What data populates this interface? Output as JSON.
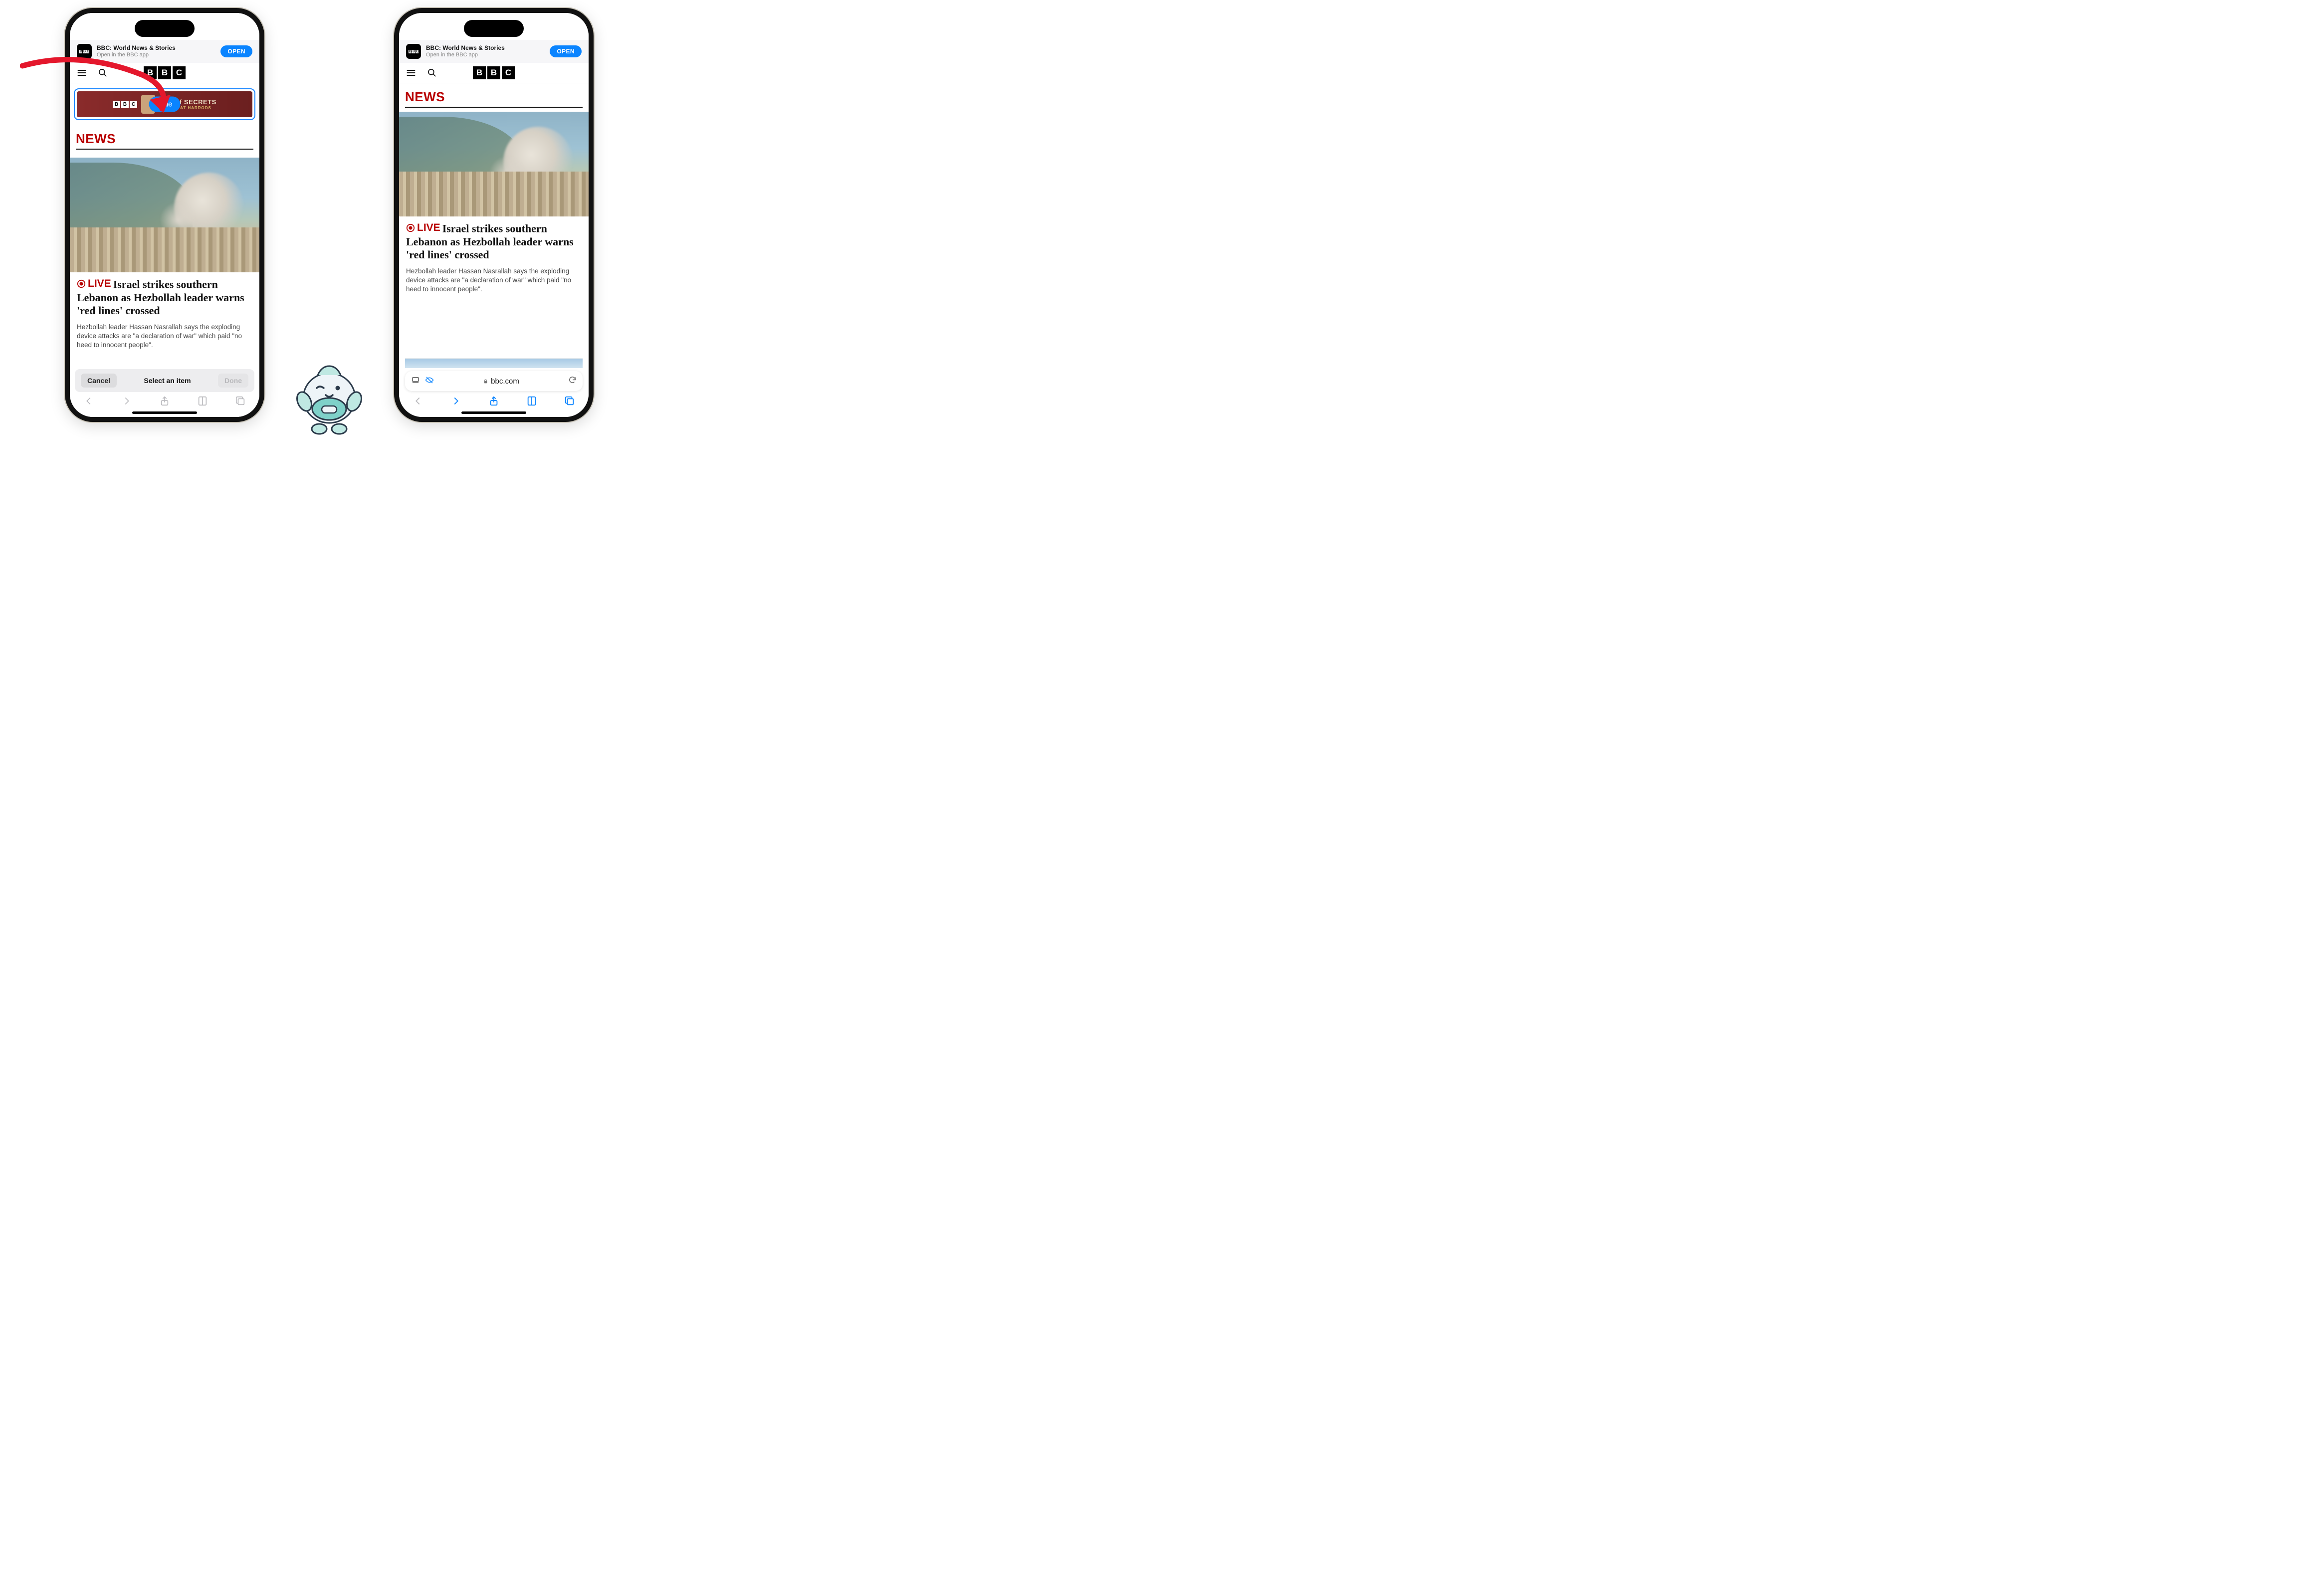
{
  "app_banner": {
    "title": "BBC: World News & Stories",
    "subtitle": "Open in the BBC app",
    "open_label": "OPEN"
  },
  "logo_letters": [
    "B",
    "B",
    "C"
  ],
  "ad": {
    "hide_label": "Hide",
    "text_top": "RLD of SECRETS",
    "text_bottom": "EDATOR AT HARRODS"
  },
  "section_heading": "NEWS",
  "article": {
    "live_label": "LIVE",
    "headline": "Israel strikes southern Lebanon as Hezbollah leader warns 'red lines' crossed",
    "summary": "Hezbollah leader Hassan Nasrallah says the exploding device attacks are \"a declaration of war\" which paid \"no heed to innocent people\"."
  },
  "selection_bar": {
    "cancel": "Cancel",
    "title": "Select an item",
    "done": "Done"
  },
  "url_bar": {
    "domain": "bbc.com"
  }
}
